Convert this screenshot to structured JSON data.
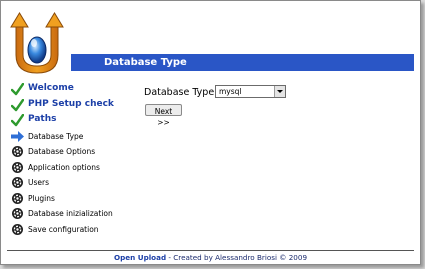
{
  "header": {
    "title": "Database Type"
  },
  "steps": [
    {
      "label": "Welcome",
      "status": "done",
      "icon": "check-icon"
    },
    {
      "label": "PHP Setup check",
      "status": "done",
      "icon": "check-icon"
    },
    {
      "label": "Paths",
      "status": "done",
      "icon": "check-icon"
    },
    {
      "label": "Database Type",
      "status": "current",
      "icon": "arrow-right-icon"
    },
    {
      "label": "Database Options",
      "status": "pending",
      "icon": "gear-icon"
    },
    {
      "label": "Application options",
      "status": "pending",
      "icon": "gear-icon"
    },
    {
      "label": "Users",
      "status": "pending",
      "icon": "gear-icon"
    },
    {
      "label": "Plugins",
      "status": "pending",
      "icon": "gear-icon"
    },
    {
      "label": "Database inizialization",
      "status": "pending",
      "icon": "gear-icon"
    },
    {
      "label": "Save configuration",
      "status": "pending",
      "icon": "gear-icon"
    }
  ],
  "form": {
    "db_label": "Database Type:",
    "db_selected": "mysql",
    "next_label": "Next >>"
  },
  "footer": {
    "link": "Open Upload",
    "rest": " - Created by Alessandro Briosi © 2009"
  },
  "colors": {
    "header_bg": "#2a56c6",
    "link": "#1c3fa7",
    "check": "#2e9a2e"
  }
}
